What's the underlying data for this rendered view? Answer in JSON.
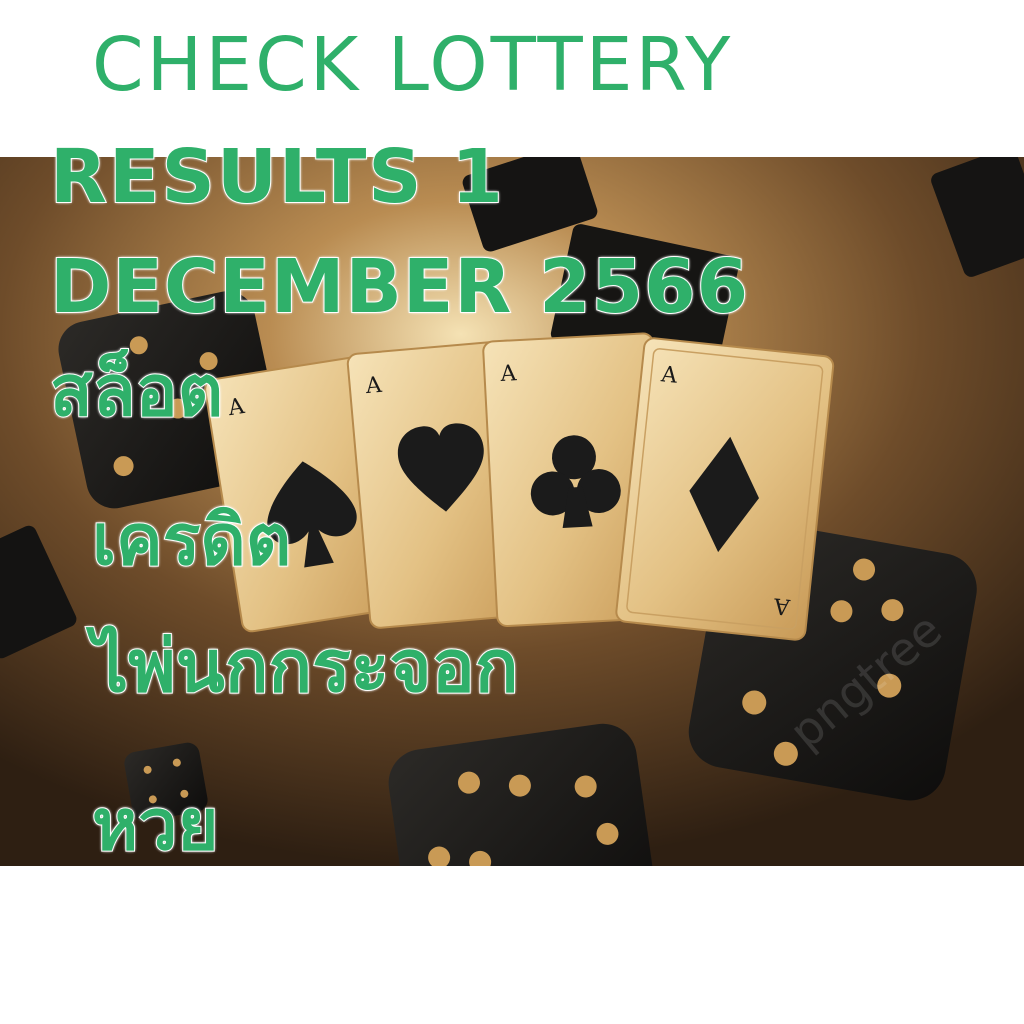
{
  "headline": {
    "line1": "CHECK LOTTERY",
    "line2": "RESULTS 1",
    "line3": "DECEMBER 2566"
  },
  "keywords": [
    "สล็อต",
    "เครดิต",
    "ไพ่นกกระจอก",
    "หวย"
  ],
  "banner": {
    "cards": [
      {
        "rank": "A",
        "suit": "spade"
      },
      {
        "rank": "A",
        "suit": "heart"
      },
      {
        "rank": "A",
        "suit": "club"
      },
      {
        "rank": "A",
        "suit": "diamond"
      }
    ],
    "watermark": "pngtree"
  },
  "colors": {
    "text_green": "#2fb06a",
    "text_outline": "#ffffff",
    "background": "#ffffff",
    "banner_dark": "#3a2a18",
    "banner_glow": "#f3d9a2",
    "card_gold": "#e8c98a",
    "dice_black": "#1b1a19",
    "pip_gold": "#c99a55"
  }
}
